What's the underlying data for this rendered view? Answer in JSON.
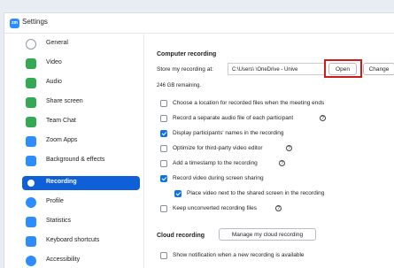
{
  "window": {
    "title": "Settings",
    "app_icon_text": "zm"
  },
  "sidebar": {
    "items": [
      {
        "label": "General",
        "icon": "gear-icon",
        "color": "#8e9aaf"
      },
      {
        "label": "Video",
        "icon": "video-icon",
        "color": "#34a853"
      },
      {
        "label": "Audio",
        "icon": "headphones-icon",
        "color": "#34a853"
      },
      {
        "label": "Share screen",
        "icon": "share-screen-icon",
        "color": "#34a853"
      },
      {
        "label": "Team Chat",
        "icon": "chat-icon",
        "color": "#34a853"
      },
      {
        "label": "Zoom Apps",
        "icon": "apps-icon",
        "color": "#2d8cff"
      },
      {
        "label": "Background & effects",
        "icon": "background-icon",
        "color": "#2d8cff"
      },
      {
        "label": "Recording",
        "icon": "record-icon",
        "color": "#ffffff",
        "active": true
      },
      {
        "label": "Profile",
        "icon": "profile-icon",
        "color": "#2d8cff"
      },
      {
        "label": "Statistics",
        "icon": "statistics-icon",
        "color": "#2d8cff"
      },
      {
        "label": "Keyboard shortcuts",
        "icon": "keyboard-icon",
        "color": "#2d8cff"
      },
      {
        "label": "Accessibility",
        "icon": "accessibility-icon",
        "color": "#2d8cff"
      }
    ]
  },
  "computer_recording": {
    "title": "Computer recording",
    "store_label": "Store my recording at:",
    "path_value": "C:\\Users\\        \\OneDrive - Unive",
    "open_label": "Open",
    "change_label": "Change",
    "remaining": "246 GB remaining."
  },
  "options": [
    {
      "label": "Choose a location for recorded files when the meeting ends",
      "checked": false,
      "help": false
    },
    {
      "label": "Record a separate audio file of each participant",
      "checked": false,
      "help": true
    },
    {
      "label": "Display participants' names in the recording",
      "checked": true,
      "help": false
    },
    {
      "label": "Optimize for third-party video editor",
      "checked": false,
      "help": true
    },
    {
      "label": "Add a timestamp to the recording",
      "checked": false,
      "help": true
    },
    {
      "label": "Record video during screen sharing",
      "checked": true,
      "help": false
    },
    {
      "label": "Place video next to the shared screen in the recording",
      "checked": true,
      "help": false,
      "indent": true
    },
    {
      "label": "Keep unconverted recording files",
      "checked": false,
      "help": true
    }
  ],
  "cloud_recording": {
    "title": "Cloud recording",
    "manage_label": "Manage my cloud recording",
    "notify_label": "Show notification when a new recording is available"
  },
  "help_glyph": "?"
}
